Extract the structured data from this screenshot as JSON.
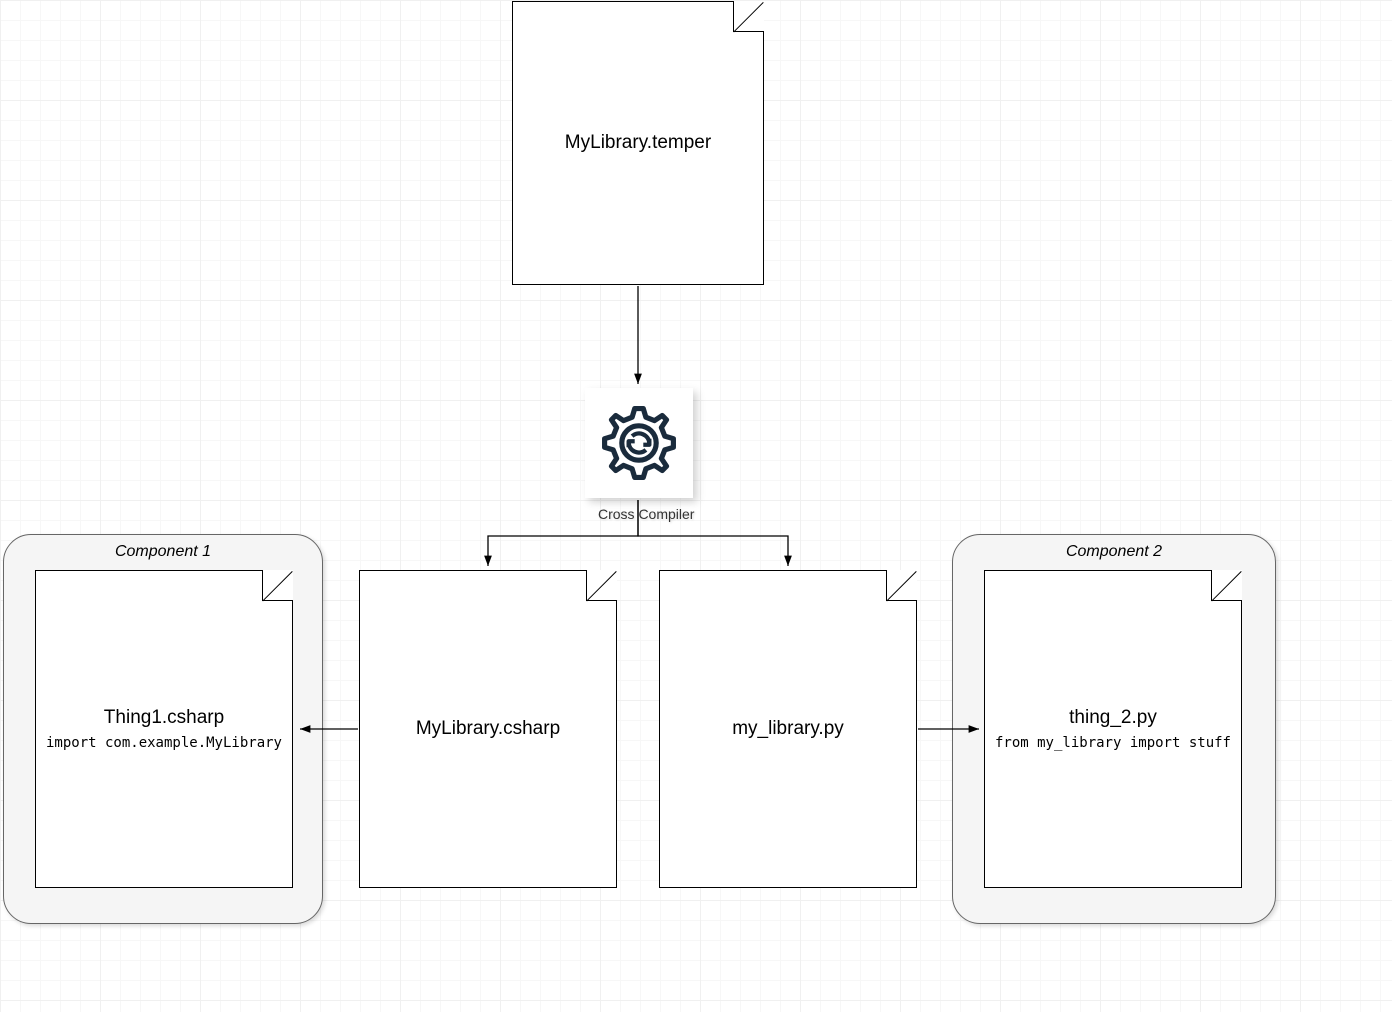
{
  "source_file": {
    "title": "MyLibrary.temper"
  },
  "compiler": {
    "label": "Cross Compiler"
  },
  "outputs": {
    "csharp": {
      "title": "MyLibrary.csharp"
    },
    "python": {
      "title": "my_library.py"
    }
  },
  "components": {
    "left": {
      "label": "Component 1",
      "file_title": "Thing1.csharp",
      "file_code": "import com.example.MyLibrary"
    },
    "right": {
      "label": "Component 2",
      "file_title": "thing_2.py",
      "file_code": "from my_library import stuff"
    }
  }
}
